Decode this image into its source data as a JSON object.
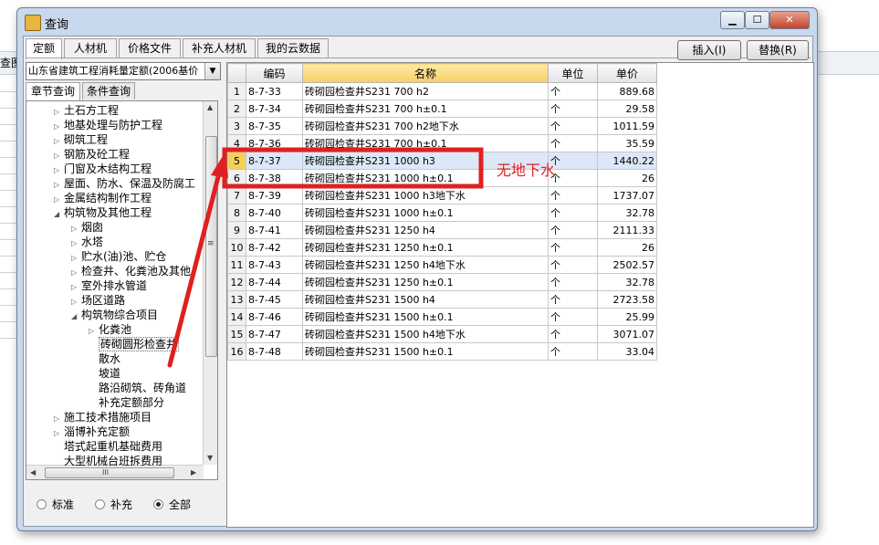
{
  "background": {
    "label": "查图"
  },
  "window": {
    "title": "查询",
    "min_glyph": "▁",
    "max_glyph": "☐",
    "close_glyph": "✕"
  },
  "tabs": [
    "定额",
    "人材机",
    "价格文件",
    "补充人材机",
    "我的云数据"
  ],
  "buttons": {
    "insert": "插入(I)",
    "replace": "替换(R)"
  },
  "left": {
    "combo_value": "山东省建筑工程消耗量定额(2006基价",
    "subtabs": [
      "章节查询",
      "条件查询"
    ],
    "tree": [
      {
        "label": "土石方工程",
        "level": 2,
        "exp": "▷"
      },
      {
        "label": "地基处理与防护工程",
        "level": 2,
        "exp": "▷"
      },
      {
        "label": "砌筑工程",
        "level": 2,
        "exp": "▷"
      },
      {
        "label": "钢筋及砼工程",
        "level": 2,
        "exp": "▷"
      },
      {
        "label": "门窗及木结构工程",
        "level": 2,
        "exp": "▷"
      },
      {
        "label": "屋面、防水、保温及防腐工",
        "level": 2,
        "exp": "▷"
      },
      {
        "label": "金属结构制作工程",
        "level": 2,
        "exp": "▷"
      },
      {
        "label": "构筑物及其他工程",
        "level": 2,
        "exp": "◢"
      },
      {
        "label": "烟囱",
        "level": 3,
        "exp": "▷"
      },
      {
        "label": "水塔",
        "level": 3,
        "exp": "▷"
      },
      {
        "label": "贮水(油)池、贮仓",
        "level": 3,
        "exp": "▷"
      },
      {
        "label": "检查井、化粪池及其他",
        "level": 3,
        "exp": "▷"
      },
      {
        "label": "室外排水管道",
        "level": 3,
        "exp": "▷"
      },
      {
        "label": "场区道路",
        "level": 3,
        "exp": "▷"
      },
      {
        "label": "构筑物综合项目",
        "level": 3,
        "exp": "◢"
      },
      {
        "label": "化粪池",
        "level": 4,
        "exp": "▷"
      },
      {
        "label": "砖砌圆形检查井",
        "level": 4,
        "exp": "",
        "selected": true
      },
      {
        "label": "散水",
        "level": 4,
        "exp": ""
      },
      {
        "label": "坡道",
        "level": 4,
        "exp": ""
      },
      {
        "label": "路沿砌筑、砖角道",
        "level": 4,
        "exp": ""
      },
      {
        "label": "补充定额部分",
        "level": 4,
        "exp": ""
      },
      {
        "label": "施工技术措施项目",
        "level": 2,
        "exp": "▷"
      },
      {
        "label": "淄博补充定额",
        "level": 2,
        "exp": "▷"
      },
      {
        "label": "塔式起重机基础费用",
        "level": 2,
        "exp": ""
      },
      {
        "label": "大型机械台班拆费用",
        "level": 2,
        "exp": ""
      }
    ],
    "scroll": {
      "up": "▲",
      "down": "▼",
      "left": "◀",
      "right": "▶",
      "grip": "≡",
      "hgrip": "III"
    },
    "radios": [
      {
        "label": "标准",
        "checked": false
      },
      {
        "label": "补充",
        "checked": false
      },
      {
        "label": "全部",
        "checked": true
      }
    ]
  },
  "grid": {
    "headers": [
      "",
      "编码",
      "名称",
      "单位",
      "单价"
    ],
    "rows": [
      [
        "1",
        "8-7-33",
        "砖砌园检查井S231 700 h2",
        "个",
        "889.68"
      ],
      [
        "2",
        "8-7-34",
        "砖砌园检查井S231 700 h±0.1",
        "个",
        "29.58"
      ],
      [
        "3",
        "8-7-35",
        "砖砌园检查井S231 700 h2地下水",
        "个",
        "1011.59"
      ],
      [
        "4",
        "8-7-36",
        "砖砌园检查井S231 700 h±0.1",
        "个",
        "35.59"
      ],
      [
        "5",
        "8-7-37",
        "砖砌园检查井S231 1000 h3",
        "个",
        "1440.22"
      ],
      [
        "6",
        "8-7-38",
        "砖砌园检查井S231 1000 h±0.1",
        "个",
        "26"
      ],
      [
        "7",
        "8-7-39",
        "砖砌园检查井S231 1000 h3地下水",
        "个",
        "1737.07"
      ],
      [
        "8",
        "8-7-40",
        "砖砌园检查井S231 1000 h±0.1",
        "个",
        "32.78"
      ],
      [
        "9",
        "8-7-41",
        "砖砌园检查井S231 1250 h4",
        "个",
        "2111.33"
      ],
      [
        "10",
        "8-7-42",
        "砖砌园检查井S231 1250 h±0.1",
        "个",
        "26"
      ],
      [
        "11",
        "8-7-43",
        "砖砌园检查井S231 1250 h4地下水",
        "个",
        "2502.57"
      ],
      [
        "12",
        "8-7-44",
        "砖砌园检查井S231 1250 h±0.1",
        "个",
        "32.78"
      ],
      [
        "13",
        "8-7-45",
        "砖砌园检查井S231 1500 h4",
        "个",
        "2723.58"
      ],
      [
        "14",
        "8-7-46",
        "砖砌园检查井S231 1500 h±0.1",
        "个",
        "25.99"
      ],
      [
        "15",
        "8-7-47",
        "砖砌园检查井S231 1500 h4地下水",
        "个",
        "3071.07"
      ],
      [
        "16",
        "8-7-48",
        "砖砌园检查井S231 1500 h±0.1",
        "个",
        "33.04"
      ]
    ],
    "selected_row": 5
  },
  "annotation": {
    "text": "无地下水",
    "color": "#e02020"
  }
}
